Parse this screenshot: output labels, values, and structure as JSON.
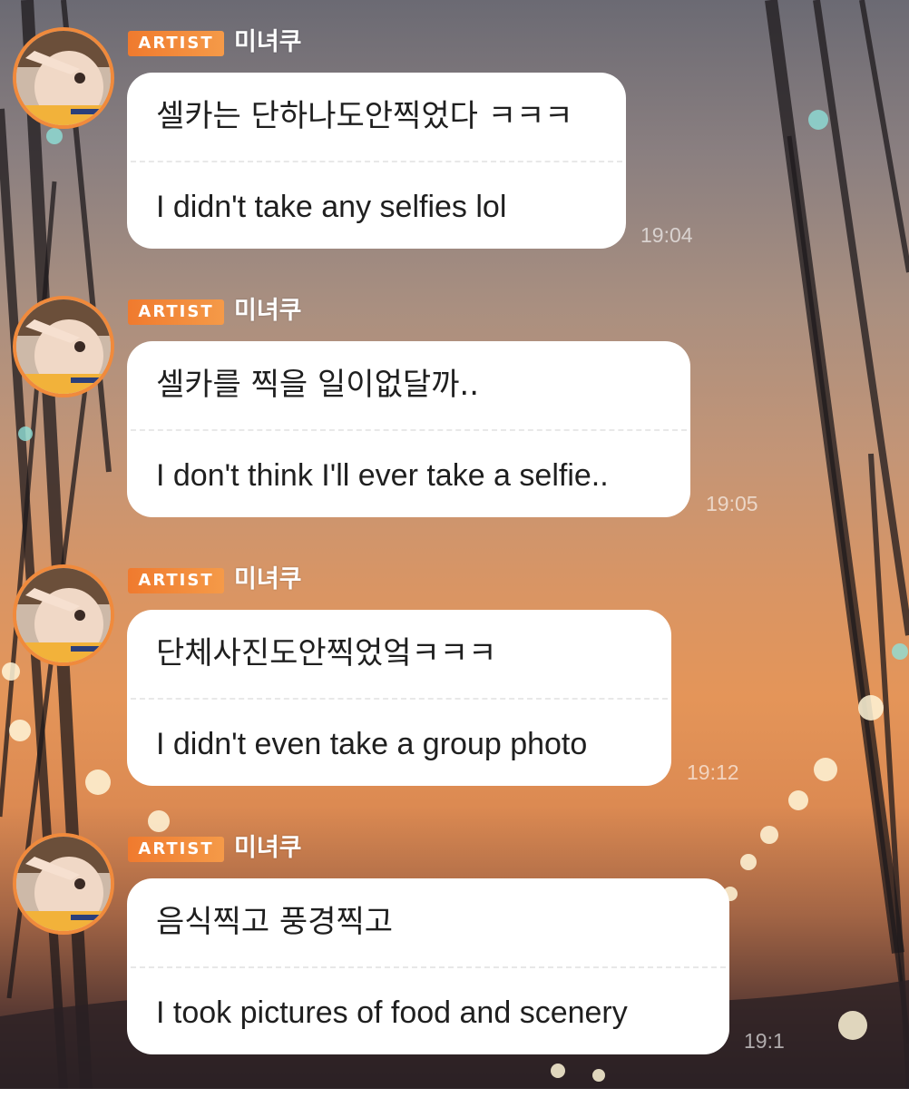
{
  "badge_label": "ARTIST",
  "colors": {
    "badge": "#f07a2e",
    "avatar_ring": "#f08a3c",
    "bubble": "#ffffff",
    "text": "#1f1f1f"
  },
  "messages": [
    {
      "author": "미녀쿠",
      "text_ko": "셀카는 단하나도안찍었다 ㅋㅋㅋ",
      "text_en": "I didn't take any selfies lol",
      "time": "19:04"
    },
    {
      "author": "미녀쿠",
      "text_ko": "셀카를 찍을 일이없달까..",
      "text_en": "I don't think I'll ever take a selfie..",
      "time": "19:05"
    },
    {
      "author": "미녀쿠",
      "text_ko": "단체사진도안찍었엌ㅋㅋㅋ",
      "text_en": "I didn't even take a group photo",
      "time": "19:12"
    },
    {
      "author": "미녀쿠",
      "text_ko": "음식찍고 풍경찍고",
      "text_en": "I took pictures of food and scenery",
      "time": "19:1"
    }
  ]
}
